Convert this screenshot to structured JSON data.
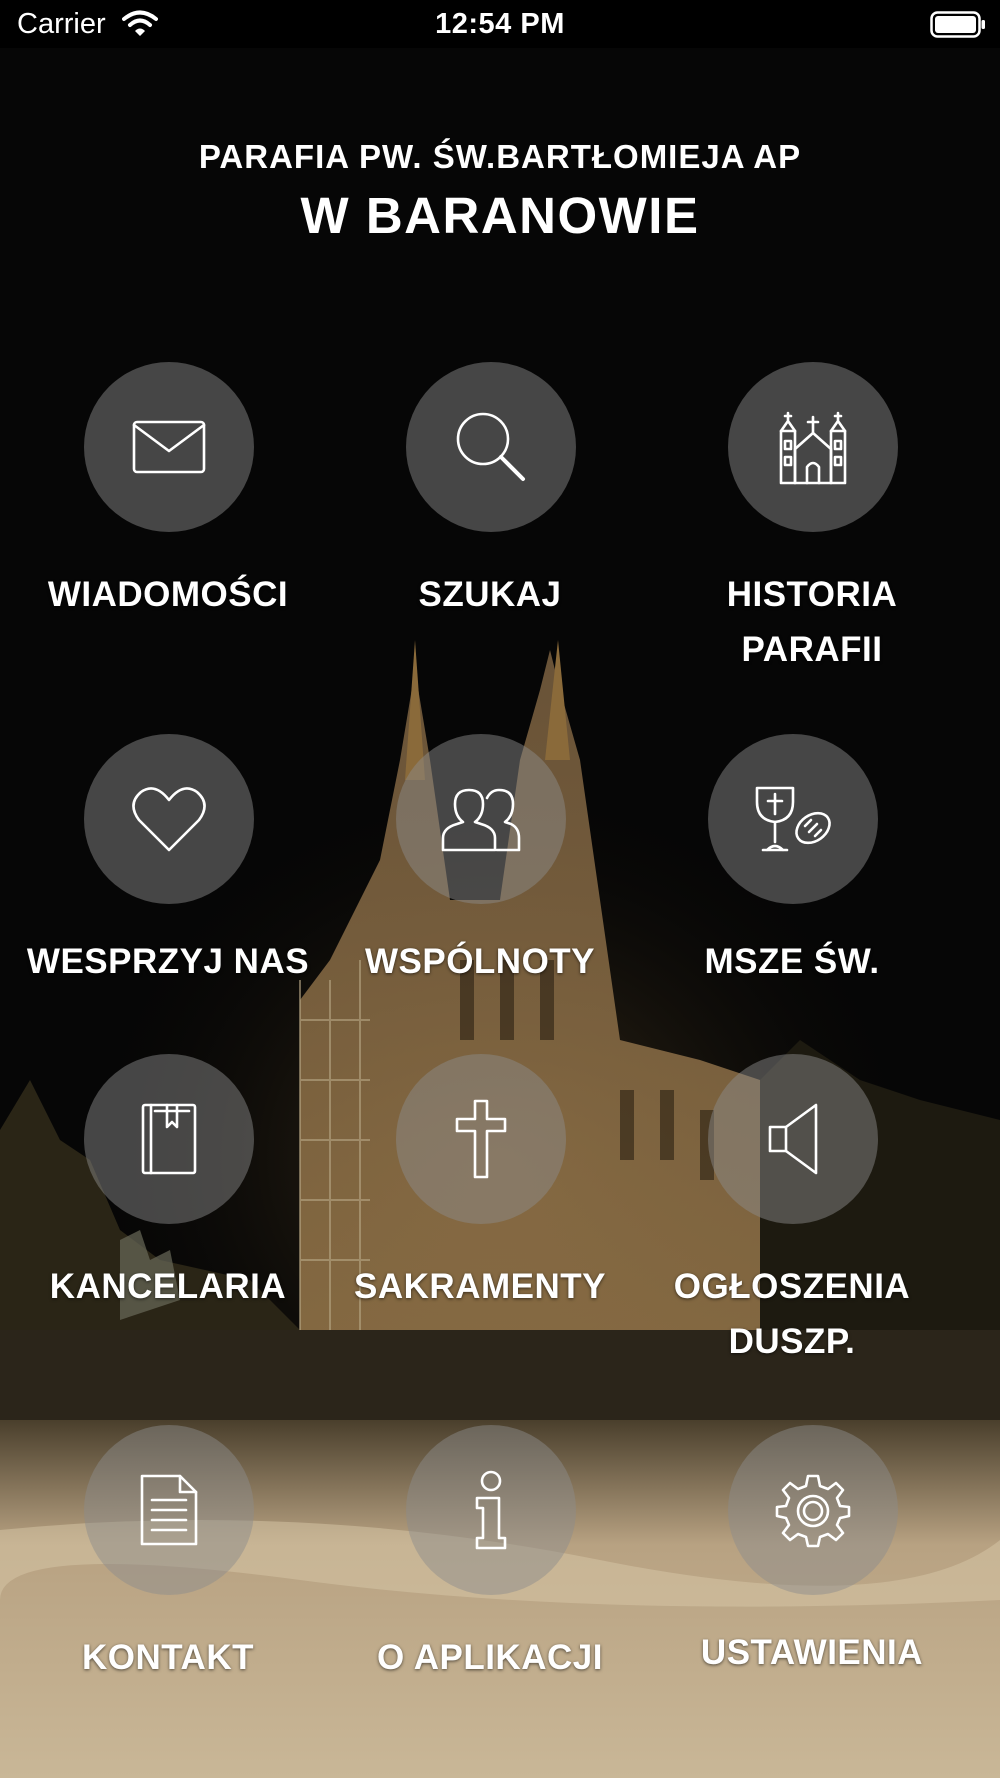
{
  "status_bar": {
    "carrier": "Carrier",
    "time": "12:54 PM"
  },
  "header": {
    "line1": "PARAFIA PW. ŚW.BARTŁOMIEJA AP",
    "line2": "W BARANOWIE"
  },
  "menu": [
    {
      "label": "WIADOMOŚCI",
      "icon": "envelope-icon"
    },
    {
      "label": "SZUKAJ",
      "icon": "search-icon"
    },
    {
      "label": "HISTORIA\nPARAFII",
      "icon": "church-icon"
    },
    {
      "label": "WESPRZYJ NAS",
      "icon": "heart-icon"
    },
    {
      "label": "WSPÓLNOTY",
      "icon": "people-icon"
    },
    {
      "label": "MSZE ŚW.",
      "icon": "chalice-bread-icon"
    },
    {
      "label": "KANCELARIA",
      "icon": "book-icon"
    },
    {
      "label": "SAKRAMENTY",
      "icon": "cross-icon"
    },
    {
      "label": "OGŁOSZENIA\nDUSZP.",
      "icon": "speaker-icon"
    },
    {
      "label": "KONTAKT",
      "icon": "document-icon"
    },
    {
      "label": "O APLIKACJI",
      "icon": "info-icon"
    },
    {
      "label": "USTAWIENIA",
      "icon": "gear-icon"
    }
  ],
  "colors": {
    "background": "#050505",
    "circle": "rgba(140,140,140,0.48)",
    "text": "#ffffff"
  }
}
